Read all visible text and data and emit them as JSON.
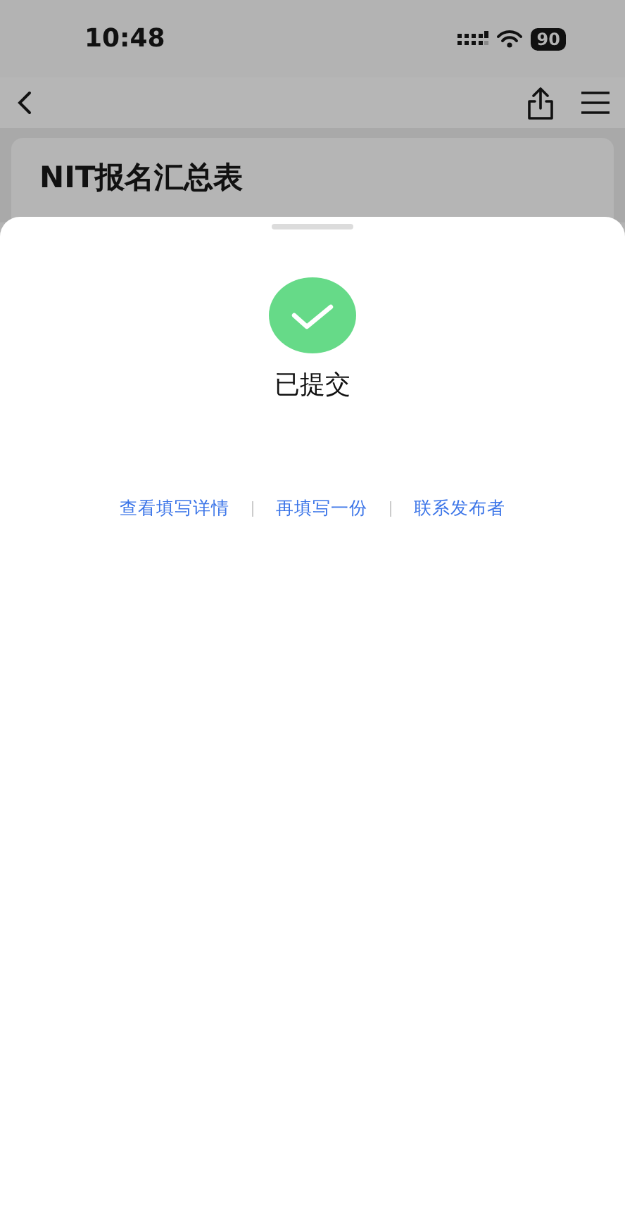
{
  "status_bar": {
    "time": "10:48",
    "battery": "90"
  },
  "form": {
    "title": "NIT报名汇总表"
  },
  "sheet": {
    "status": "已提交",
    "links": [
      "查看填写详情",
      "再填写一份",
      "联系发布者"
    ]
  }
}
